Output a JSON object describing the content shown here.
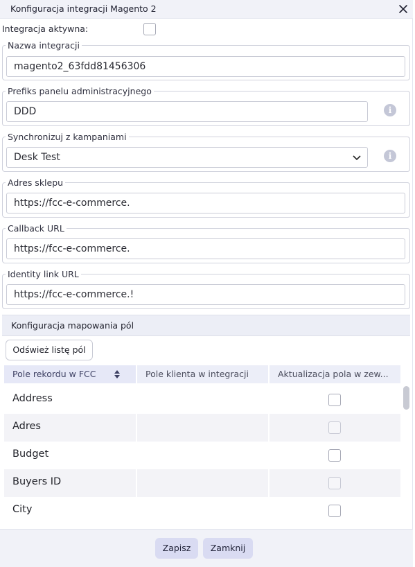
{
  "dialog": {
    "title": "Konfiguracja integracji Magento 2",
    "close_icon": "close-icon"
  },
  "active": {
    "label": "Integracja aktywna:",
    "checked": false
  },
  "fields": {
    "name": {
      "legend": "Nazwa integracji",
      "value": "magento2_63fdd81456306"
    },
    "admin_prefix": {
      "legend": "Prefiks panelu administracyjnego",
      "value": "DDD",
      "icon": "info-icon"
    },
    "campaign": {
      "legend": "Synchronizuj z kampaniami",
      "value": "Desk Test",
      "icon": "info-icon"
    },
    "shop_address": {
      "legend": "Adres sklepu",
      "value": "https://fcc-e-commerce."
    },
    "callback_url": {
      "legend": "Callback URL",
      "value": "https://fcc-e-commerce."
    },
    "identity_link_url": {
      "legend": "Identity link URL",
      "value": "https://fcc-e-commerce.!"
    }
  },
  "mapping": {
    "header": "Konfiguracja mapowania pól",
    "refresh_label": "Odśwież listę pól",
    "columns": [
      "Pole rekordu w FCC",
      "Pole klienta w integracji",
      "Aktualizacja pola w zew..."
    ],
    "rows": [
      {
        "name": "Address",
        "client_field": "",
        "update": false
      },
      {
        "name": "Adres",
        "client_field": "",
        "update": false
      },
      {
        "name": "Budget",
        "client_field": "",
        "update": false
      },
      {
        "name": "Buyers ID",
        "client_field": "",
        "update": false
      },
      {
        "name": "City",
        "client_field": "",
        "update": false
      }
    ]
  },
  "footer": {
    "save_label": "Zapisz",
    "close_label": "Zamknij"
  },
  "colors": {
    "header_bg": "#f1f2f8",
    "button_bg": "#d9dbf2",
    "info_icon": "#c4c7d7"
  }
}
